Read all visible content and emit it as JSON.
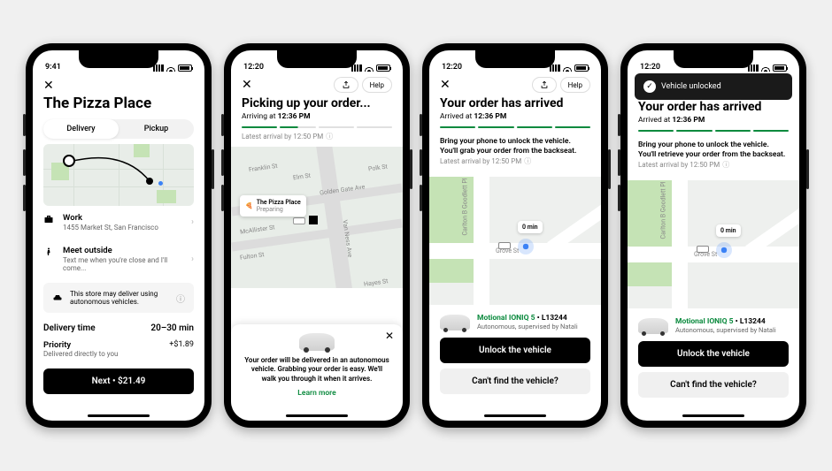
{
  "status": {
    "time1": "9:41",
    "time2": "12:20"
  },
  "phone1": {
    "title": "The Pizza Place",
    "tabs": {
      "delivery": "Delivery",
      "pickup": "Pickup"
    },
    "work": {
      "label": "Work",
      "sub": "1455 Market St, San Francisco"
    },
    "meet": {
      "label": "Meet outside",
      "sub": "Text me when you're close and I'll come..."
    },
    "av_note": "This store may deliver using autonomous vehicles.",
    "delivery_time_label": "Delivery time",
    "delivery_time_value": "20–30 min",
    "priority_label": "Priority",
    "priority_sub": "Delivered directly to you",
    "priority_price": "+$1.89",
    "next": "Next • $21.49"
  },
  "phone2": {
    "help": "Help",
    "title": "Picking up your order...",
    "arriving": "Arriving at 12:36 PM",
    "latest": "Latest arrival by 12:50 PM",
    "callout_title": "The Pizza Place",
    "callout_sub": "Preparing",
    "streets": {
      "franklin": "Franklin St",
      "elm": "Elm St",
      "golden": "Golden Gate Ave",
      "mcallister": "McAllister St",
      "fulton": "Fulton St",
      "vanness": "Van Ness Ave",
      "polk": "Polk St",
      "hayes": "Hayes St"
    },
    "sheet_text": "Your order will be delivered in an autonomous vehicle. Grabbing your order is easy. We'll walk you through it when it arrives.",
    "learn_more": "Learn more"
  },
  "phone3": {
    "title": "Your order has arrived",
    "arrived": "Arrived at 12:36 PM",
    "instruct": "Bring your phone to unlock the vehicle. You'll grab your order from the backseat.",
    "latest": "Latest arrival by 12:50 PM",
    "eta": "0 min",
    "streets": {
      "carlton": "Carlton B Goodlett Pl",
      "grove": "Grove St"
    },
    "vehicle_model": "Motional IONIQ 5",
    "vehicle_plate": "L13244",
    "vehicle_sub": "Autonomous, supervised by Natali",
    "unlock": "Unlock the vehicle",
    "cant_find": "Can't find the vehicle?"
  },
  "phone4": {
    "toast": "Vehicle unlocked",
    "title": "Your order has arrived",
    "arrived": "Arrived at 12:36 PM",
    "instruct": "Bring your phone to unlock the vehicle. You'll retrieve your order from the backseat.",
    "latest": "Latest arrival by 12:50 PM",
    "eta": "0 min",
    "vehicle_model": "Motional IONIQ 5",
    "vehicle_plate": "L13244",
    "vehicle_sub": "Autonomous, supervised by Natali",
    "unlock": "Unlock the vehicle",
    "cant_find": "Can't find the vehicle?"
  }
}
